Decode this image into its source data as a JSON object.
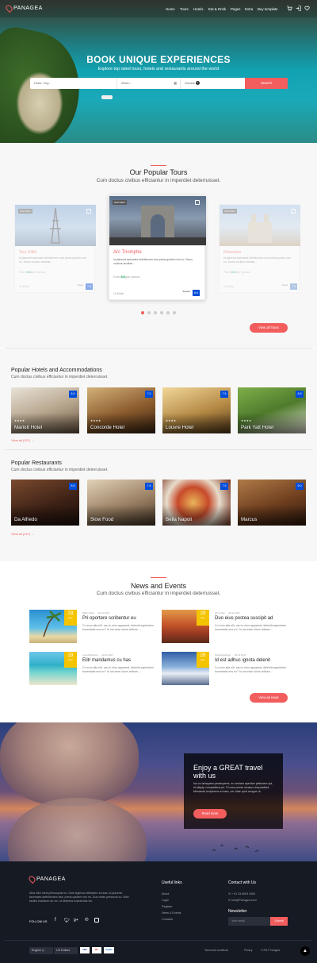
{
  "brand": {
    "name": "PANAGEA",
    "accent": "#f25d5d",
    "score_color": "#004dda"
  },
  "nav": {
    "items": [
      "Home",
      "Tours",
      "Hotels",
      "Eat & Drink",
      "Pages",
      "Extra",
      "Buy template"
    ],
    "icons": [
      "cart-icon",
      "login-icon",
      "heart-icon"
    ]
  },
  "hero": {
    "title": "BOOK UNIQUE EXPERIENCES",
    "subtitle": "Explore top rated tours, hotels and restaurants around the world",
    "search": {
      "where_placeholder": "Hotel, City...",
      "when_placeholder": "When...",
      "guests_label": "Guests",
      "guests_count": "1",
      "button": "Search"
    }
  },
  "tours": {
    "title": "Our Popular Tours",
    "subtitle": "Cum doctus civibus efficiantur in imperdiet deterruisset.",
    "cards": [
      {
        "badge": "HISTORIC",
        "name": "Tour Eiffel",
        "desc": "Id placerat tacimates definitionem sea prima quidem vim no. Sumo vocibus ancillae...",
        "price_label": "From",
        "price": "$54",
        "price_suffix": "/per person",
        "duration": "1h 30min",
        "rating_text": "Good",
        "reviews": "350 Reviews",
        "score": "7.8"
      },
      {
        "badge": "HISTORIC",
        "name": "Arc Triomphe",
        "desc": "Id placerat tacimates definitionem sea prima quidem vim no. Sumo vocibus ancillae...",
        "price_label": "From",
        "price": "$54",
        "price_suffix": "/per person",
        "duration": "1h 30min",
        "rating_text": "Superb",
        "reviews": "350 Reviews",
        "score": "8.9"
      },
      {
        "badge": "HISTORIC",
        "name": "Notredam",
        "desc": "Id placerat tacimates definitionem sea prima quidem vim no. Sumo vocibus ancillae...",
        "price_label": "From",
        "price": "$54",
        "price_suffix": "/per person",
        "duration": "1h 30min",
        "rating_text": "Good",
        "reviews": "350 Reviews",
        "score": "7.5"
      }
    ],
    "button": "View all Tours"
  },
  "hotels": {
    "title": "Popular Hotels and Accommodations",
    "subtitle": "Cum doctus civibus efficiantur in imperdiet deterruisset.",
    "items": [
      {
        "name": "Mariott Hotel",
        "stars": "★★★★",
        "score": "8.9"
      },
      {
        "name": "Concorde Hotel",
        "stars": "★★★★",
        "score": "7.0"
      },
      {
        "name": "Louvre Hotel",
        "stars": "★★★★",
        "score": "7.5"
      },
      {
        "name": "Park Yatt Hotel",
        "stars": "★★★★",
        "score": "8.9"
      }
    ],
    "view_all": "View all (157)"
  },
  "restaurants": {
    "title": "Popular Restaurants",
    "subtitle": "Cum doctus civibus efficiantur in imperdiet deterruisset.",
    "items": [
      {
        "name": "Da Alfredo",
        "score": "8.5"
      },
      {
        "name": "Slow Food",
        "score": "7.8"
      },
      {
        "name": "Bella Napoli",
        "score": "7.5"
      },
      {
        "name": "Marcus",
        "score": "9.0"
      }
    ],
    "view_all": "View all (157)"
  },
  "news": {
    "title": "News and Events",
    "subtitle": "Cum doctus civibus efficiantur in imperdiet deterruisset.",
    "items": [
      {
        "day": "28",
        "month": "Dec",
        "author": "Mark Twain",
        "date": "20.11.2017",
        "title": "Pri oportere scribentur eu",
        "text": "Cu eum alia elit, usu in eius appareat, deleniti sapientem honestatis eos ex? In ius esse ullum vidisse...."
      },
      {
        "day": "28",
        "month": "Dec",
        "author": "Jhon Doe",
        "date": "20.11.2017",
        "title": "Duo eius postea suscipit ad",
        "text": "Cu eum alia elit, usu in eius appareat, deleniti sapientem honestatis eos ex? In ius esse ullum vidisse...."
      },
      {
        "day": "28",
        "month": "Dec",
        "author": "Luca Robinson",
        "date": "20.11.2017",
        "title": "Elitr mandamus cu has",
        "text": "Cu eum alia elit, usu in eius appareat, deleniti sapientem honestatis eos ex? In ius esse ullum vidisse...."
      },
      {
        "day": "28",
        "month": "Dec",
        "author": "Paula Rodrigez",
        "date": "20.11.2017",
        "title": "Id est adhuc ignota delenit",
        "text": "Cu eum alia elit, usu in eius appareat, deleniti sapientem honestatis eos ex? In ius esse ullum vidisse...."
      }
    ],
    "button": "View all news"
  },
  "banner": {
    "title": "Enjoy a GREAT travel with us",
    "text": "Ius cu tamquam persequeris, eu veniam apeirian platonem qui, id aliquip voluptatibus pri. Ei mea primis ornatus disputationi. Menandri scriptorem ei eam, vel vitae quot congue ut.",
    "button": "Read more"
  },
  "footer": {
    "about": "Mea nibh meis philosophia eu. Duis legimus efficiantur ea sea. Id placerat tacimates definitionem sea, prima quidem vim no. Duo nobis persecuti cu. Nihil facilisi indoctum an vix, ut delectus expetendis vis.",
    "follow_label": "FOLLOW US",
    "social": [
      "facebook-icon",
      "twitter-icon",
      "google-plus-icon",
      "pinterest-icon",
      "instagram-icon"
    ],
    "useful_title": "Useful links",
    "useful_links": [
      "About",
      "Login",
      "Register",
      "News & Events",
      "Contacts"
    ],
    "contact_title": "Contact with Us",
    "phone": "+ 61 23 8093 3400",
    "email": "info@Panagea.com",
    "newsletter_title": "Newsletter",
    "newsletter_placeholder": "Your email",
    "newsletter_button": "Submit",
    "language": "English",
    "currency": "US Dollars",
    "payments": [
      "VISA",
      "MC",
      "PayPal"
    ],
    "bottom_links": [
      "Terms and conditions",
      "Privacy"
    ],
    "copyright": "© 2017 Panagea"
  }
}
